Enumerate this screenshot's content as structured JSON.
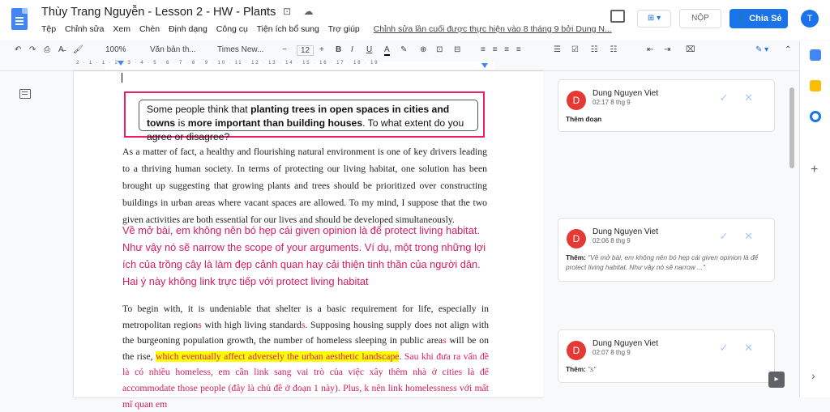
{
  "document": {
    "title": "Thùy Trang Nguyễn - Lesson 2 - HW - Plants",
    "title_icons": "☆ ⊡ ☁",
    "menu": [
      "Tệp",
      "Chỉnh sửa",
      "Xem",
      "Chèn",
      "Định dạng",
      "Công cụ",
      "Tiện ích bổ sung",
      "Trợ giúp"
    ],
    "last_edit": "Chỉnh sửa lần cuối được thực hiện vào 8 tháng 9 bởi Dung N..."
  },
  "header_buttons": {
    "present": "⊞ ▾",
    "submit": "NỘP",
    "share": "👤 Chia Sẻ",
    "user_initial": "T"
  },
  "toolbar": {
    "undo": "↶",
    "redo": "↷",
    "print": "⎙",
    "spell": "A̶",
    "paint": "🖌",
    "zoom": "100%",
    "style": "Văn bản th...",
    "font": "Times New...",
    "minus": "−",
    "font_size": "12",
    "plus": "+",
    "bold": "B",
    "italic": "I",
    "underline": "U",
    "text_color": "A",
    "highlight": "✎",
    "link": "⊕",
    "comment": "⊡",
    "image": "⊟",
    "align": "≡ ≡ ≡ ≡",
    "spacing": "☰",
    "lists": "☑ ☷ ☷",
    "indent": "⇤ ⇥",
    "clear": "⌧",
    "editing": "✎ ▾",
    "collapse": "⌃"
  },
  "ruler_numbers": "2 · 1 · 1 · 2 · 3 · 4 · 5 · 6 · 7 · 8 · 9 · 10 · 11 · 12 · 13 · 14 · 15 · 16 · 17 · 18 · 19",
  "prompt": {
    "part1": "Some people think that ",
    "bold1": "planting trees in open spaces in cities and towns",
    "part2": " is ",
    "bold2": "more important than building houses",
    "part3": ". To what extent do you agree or disagree?"
  },
  "paragraph1": "As a matter of fact, a healthy and flourishing natural environment is one of key drivers leading to a thriving human society. In terms of protecting our living habitat, one solution has been brought up suggesting that growing plants and trees should be prioritized over constructing buildings in urban areas where vacant spaces are allowed. To my mind, I suppose that the two given activities are both essential for our lives and should be developed simultaneously.",
  "vietnamese_comment": " Về mở bài, em không nên bó hẹp cái given opinion là để protect living habitat. Như vậy nó sẽ narrow the scope of your arguments. Ví dụ, một trong những lợi ích của trồng cây là làm đẹp cảnh quan hay cải thiện tinh thần của người dân. Hai ý này không link trực tiếp với protect living habitat",
  "paragraph2": {
    "t1": "To begin with, it is undeniable that shelter is a basic requirement for life, especially in metropolitan region",
    "s1": "s",
    "t2": " with high living standard",
    "s2": "s",
    "t3": ". Supposing housing supply does not align with the burgeoning population growth, the number of homeless sleeping in public area",
    "s3": "s",
    "t4": " will be on the rise, ",
    "highlighted": "which eventually affect adversely the urban aesthetic landscape",
    "t5": ". ",
    "pink_tail": "Sau khi đưa ra vấn đề là có nhiều homeless, em cần link sang vai trò của việc xây thêm nhà ở cities là để accommodate those people (đây là chủ đề ở đoạn 1 này). Plus, k nên link homelessness với mất mĩ quan em"
  },
  "comments": [
    {
      "initial": "D",
      "author": "Dung Nguyen Viet",
      "time": "02:17 8 thg 9",
      "label": "Thêm đoạn",
      "text": ""
    },
    {
      "initial": "D",
      "author": "Dung Nguyen Viet",
      "time": "02:06 8 thg 9",
      "label": "Thêm:",
      "text": "\"Về mở bài, em không nên bó hẹp cái given opinion là để protect living habitat. Như vậy nó sẽ narrow ...\""
    },
    {
      "initial": "D",
      "author": "Dung Nguyen Viet",
      "time": "02:07 8 thg 9",
      "label": "Thêm:",
      "text": "\"s\""
    }
  ],
  "comment_actions": "✓ ✕",
  "sidebar_plus": "+",
  "sidebar_chevron": "›",
  "colors": {
    "accent": "#1a73e8",
    "comment_pink": "#d81b60",
    "highlight": "#ffff00",
    "box_border": "#e91e63"
  }
}
